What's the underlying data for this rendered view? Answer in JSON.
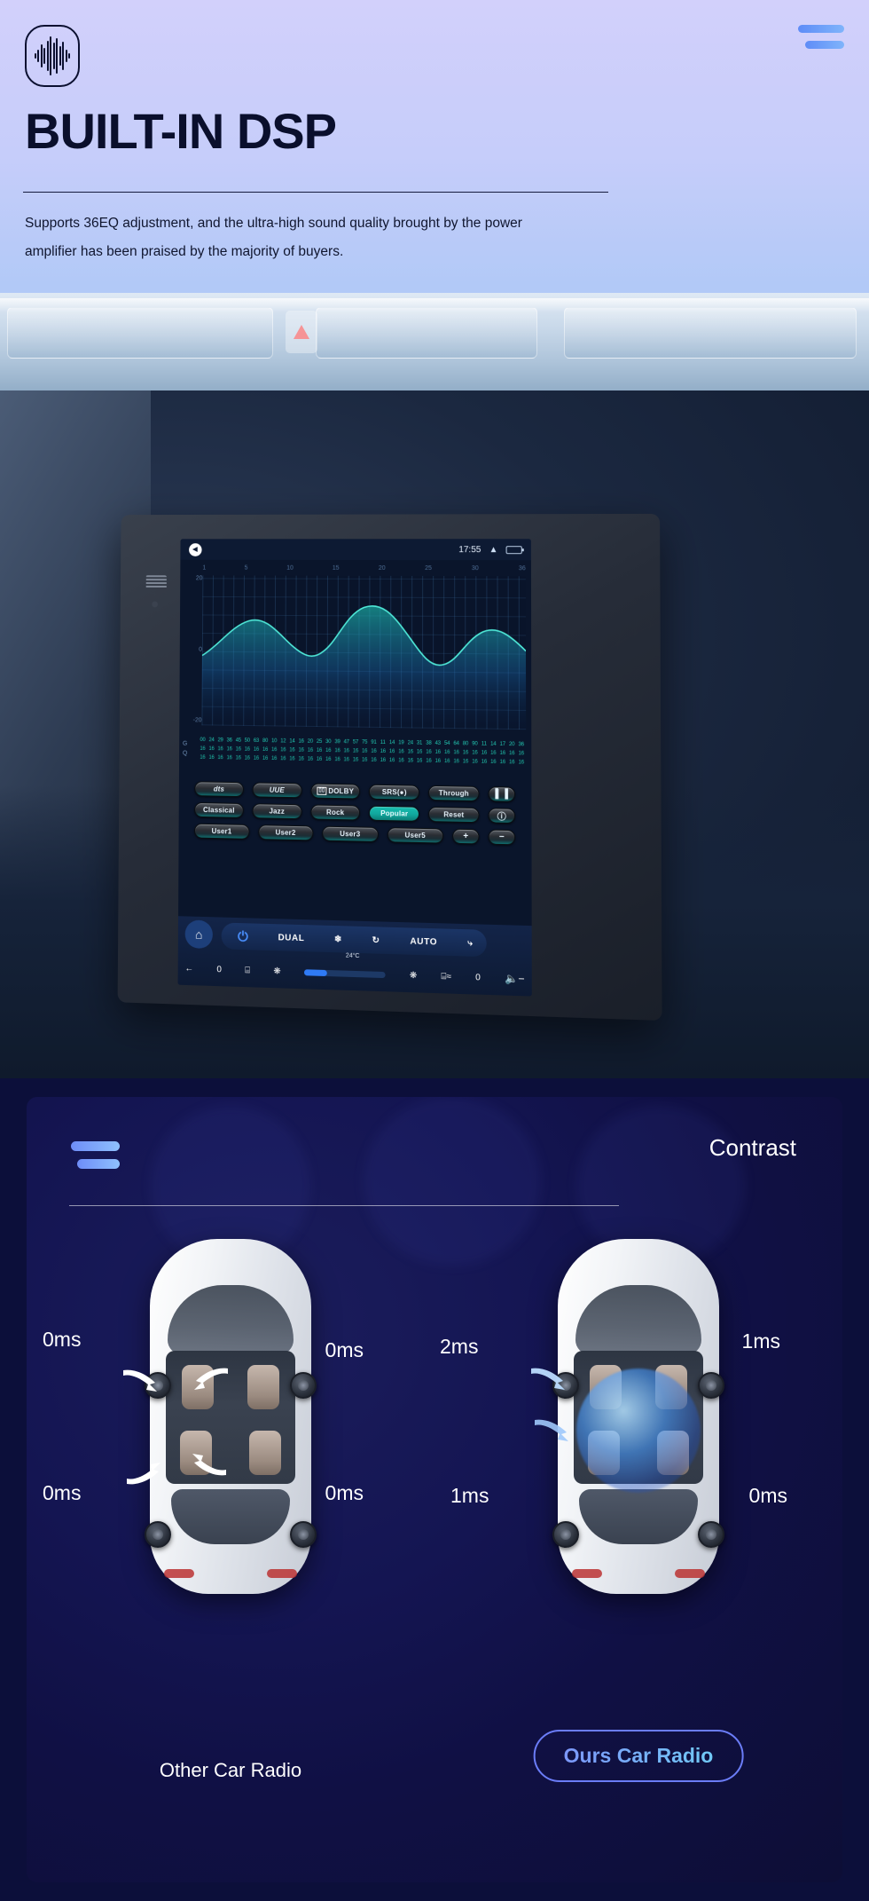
{
  "hero": {
    "logo_icon": "sound-wave-icon",
    "menu_icon": "hamburger-icon",
    "title": "BUILT-IN DSP",
    "description": "Supports 36EQ adjustment, and the ultra-high sound quality brought by the power amplifier has been praised by the majority of buyers."
  },
  "dsp_screen": {
    "status_bar": {
      "speaker_icon": "speaker-mute-icon",
      "time": "17:55",
      "expand_icon": "chevron-up-icon",
      "battery_icon": "battery-icon"
    },
    "equalizer": {
      "x_ticks": [
        "1",
        "5",
        "10",
        "15",
        "20",
        "25",
        "30",
        "36"
      ],
      "y_ticks": [
        "20",
        "0",
        "-20"
      ],
      "gq_label_top": "G",
      "gq_label_bottom": "Q",
      "band_numbers": [
        "00",
        "24",
        "29",
        "36",
        "45",
        "50",
        "63",
        "80",
        "10",
        "12",
        "14",
        "16",
        "20",
        "25",
        "30",
        "39",
        "47",
        "57",
        "75",
        "91",
        "11",
        "14",
        "19",
        "24",
        "31",
        "38",
        "43",
        "54",
        "64",
        "80",
        "90",
        "11",
        "14",
        "17",
        "20",
        "36"
      ],
      "gain_values": [
        "16",
        "16",
        "16",
        "16",
        "16",
        "16",
        "16",
        "16",
        "16",
        "16",
        "16",
        "16",
        "16",
        "16",
        "16",
        "16",
        "16",
        "16",
        "16",
        "16",
        "16",
        "16",
        "16",
        "16",
        "16",
        "16",
        "16",
        "16",
        "16",
        "16",
        "16",
        "16",
        "16",
        "16",
        "16",
        "16"
      ],
      "q_values": [
        "16",
        "16",
        "16",
        "16",
        "16",
        "16",
        "16",
        "16",
        "16",
        "16",
        "16",
        "16",
        "16",
        "16",
        "16",
        "16",
        "16",
        "16",
        "16",
        "16",
        "16",
        "16",
        "16",
        "16",
        "16",
        "16",
        "16",
        "16",
        "16",
        "16",
        "16",
        "16",
        "16",
        "16",
        "16",
        "16"
      ]
    },
    "presets": {
      "row1": [
        "dts",
        "UUE",
        "DOLBY",
        "SRS",
        "Through",
        "surround-icon"
      ],
      "row2": [
        "Classical",
        "Jazz",
        "Rock",
        "Popular",
        "Reset",
        "info-icon"
      ],
      "row3": [
        "User1",
        "User2",
        "User3",
        "User5",
        "plus-icon",
        "minus-icon"
      ],
      "active": "Popular"
    },
    "climate": {
      "home_icon": "home-icon",
      "back_icon": "back-arrow-icon",
      "power_icon": "power-icon",
      "dual_label": "DUAL",
      "snowflake_icon": "snowflake-icon",
      "recirculate_icon": "air-recirculate-icon",
      "auto_label": "AUTO",
      "defrost_icon": "defrost-icon",
      "temperature": "24°C",
      "left_temp": "0",
      "right_temp": "0",
      "seat_icon": "seat-icon",
      "heated_seat_icon": "heated-seat-icon",
      "fan_low_icon": "fan-icon",
      "fan_high_icon": "fan-icon",
      "volume_up_icon": "volume-up-icon",
      "volume_down_icon": "volume-down-icon"
    }
  },
  "contrast": {
    "menu_icon": "hamburger-icon",
    "title": "Contrast",
    "left_car": {
      "label": "Other Car Radio",
      "delays": {
        "front_left": "0ms",
        "front_right": "0ms",
        "rear_left": "0ms",
        "rear_right": "0ms"
      }
    },
    "right_car": {
      "label": "Ours Car Radio",
      "delays": {
        "front_left": "2ms",
        "front_right": "1ms",
        "rear_left": "1ms",
        "rear_right": "0ms"
      }
    }
  }
}
